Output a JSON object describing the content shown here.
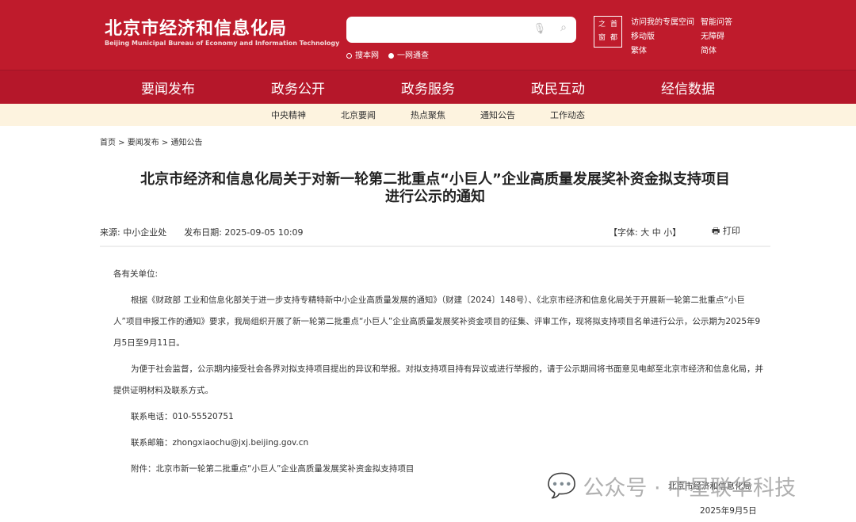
{
  "header": {
    "title_cn": "北京市经济和信息化局",
    "title_en": "Beijing Municipal Bureau of Economy and Information Technology",
    "search_placeholder": "",
    "search_options": [
      "搜本网",
      "一网通查"
    ],
    "seal_text": [
      "首",
      "之",
      "都",
      "窗"
    ],
    "links": [
      "访问我的专属空间",
      "智能问答",
      "移动版",
      "无障碍",
      "繁体",
      "简体"
    ]
  },
  "nav": [
    "要闻发布",
    "政务公开",
    "政务服务",
    "政民互动",
    "经信数据"
  ],
  "subnav": [
    "中央精神",
    "北京要闻",
    "热点聚焦",
    "通知公告",
    "工作动态"
  ],
  "breadcrumb": "首页 > 要闻发布 > 通知公告",
  "article": {
    "title_line1": "北京市经济和信息化局关于对新一轮第二批重点“小巨人”企业高质量发展奖补资金拟支持项目",
    "title_line2": "进行公示的通知",
    "source": "来源:  中小企业处",
    "date": "发布日期:  2025-09-05 10:09",
    "font_size": "【字体:  大 中 小】",
    "print": "打印",
    "salutation": "各有关单位:",
    "para1": "根据《财政部 工业和信息化部关于进一步支持专精特新中小企业高质量发展的通知》（财建〔2024〕148号）、《北京市经济和信息化局关于开展新一轮第二批重点“小巨人”项目申报工作的通知》要求，我局组织开展了新一轮第二批重点“小巨人”企业高质量发展奖补资金项目的征集、评审工作，现将拟支持项目名单进行公示，公示期为2025年9月5日至9月11日。",
    "para2": "为便于社会监督，公示期内接受社会各界对拟支持项目提出的异议和举报。对拟支持项目持有异议或进行举报的，请于公示期间将书面意见电邮至北京市经济和信息化局，并提供证明材料及联系方式。",
    "phone": "联系电话：010-55520751",
    "email": "联系邮箱：zhongxiaochu@jxj.beijing.gov.cn",
    "attachment": "附件：北京市新一轮第二批重点“小巨人”企业高质量发展奖补资金拟支持项目",
    "signature": "北京市经济和信息化局",
    "sign_date": "2025年9月5日"
  },
  "watermark": "公众号 · 中星联华科技",
  "colors": {
    "brand": "#bf1b2c",
    "subnav_bg": "#fdf3df"
  }
}
